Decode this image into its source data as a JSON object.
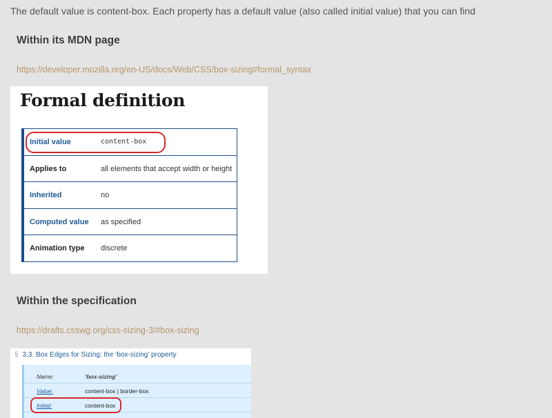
{
  "intro_text": "The default value is content-box. Each property has a default value (also called initial value) that you can find",
  "section1": {
    "heading": "Within its MDN page",
    "link": "https://developer.mozilla.org/en-US/docs/Web/CSS/box-sizing#formal_syntax"
  },
  "mdn": {
    "title": "Formal definition",
    "rows": [
      {
        "key": "Initial value",
        "value": "content-box"
      },
      {
        "key": "Applies to",
        "value": "all elements that accept width or height"
      },
      {
        "key": "Inherited",
        "value": "no"
      },
      {
        "key": "Computed value",
        "value": "as specified"
      },
      {
        "key": "Animation type",
        "value": "discrete"
      }
    ]
  },
  "section2": {
    "heading": "Within the specification",
    "link": "https://drafts.csswg.org/css-sizing-3/#box-sizing"
  },
  "spec": {
    "section_mark": "§",
    "header": "3.3. Box Edges for Sizing: the ‘box-sizing’ property",
    "rows": [
      {
        "key": "Name:",
        "value": "‘box-sizing’"
      },
      {
        "key": "Value:",
        "value": "content-box | border-box"
      },
      {
        "key": "Initial:",
        "value": "content-box"
      }
    ]
  },
  "colors": {
    "background": "#e4e4e4",
    "link": "#b9946a",
    "highlight": "#d6262a",
    "mdn_border": "#1c4c8c",
    "spec_bg": "#def0ff"
  }
}
